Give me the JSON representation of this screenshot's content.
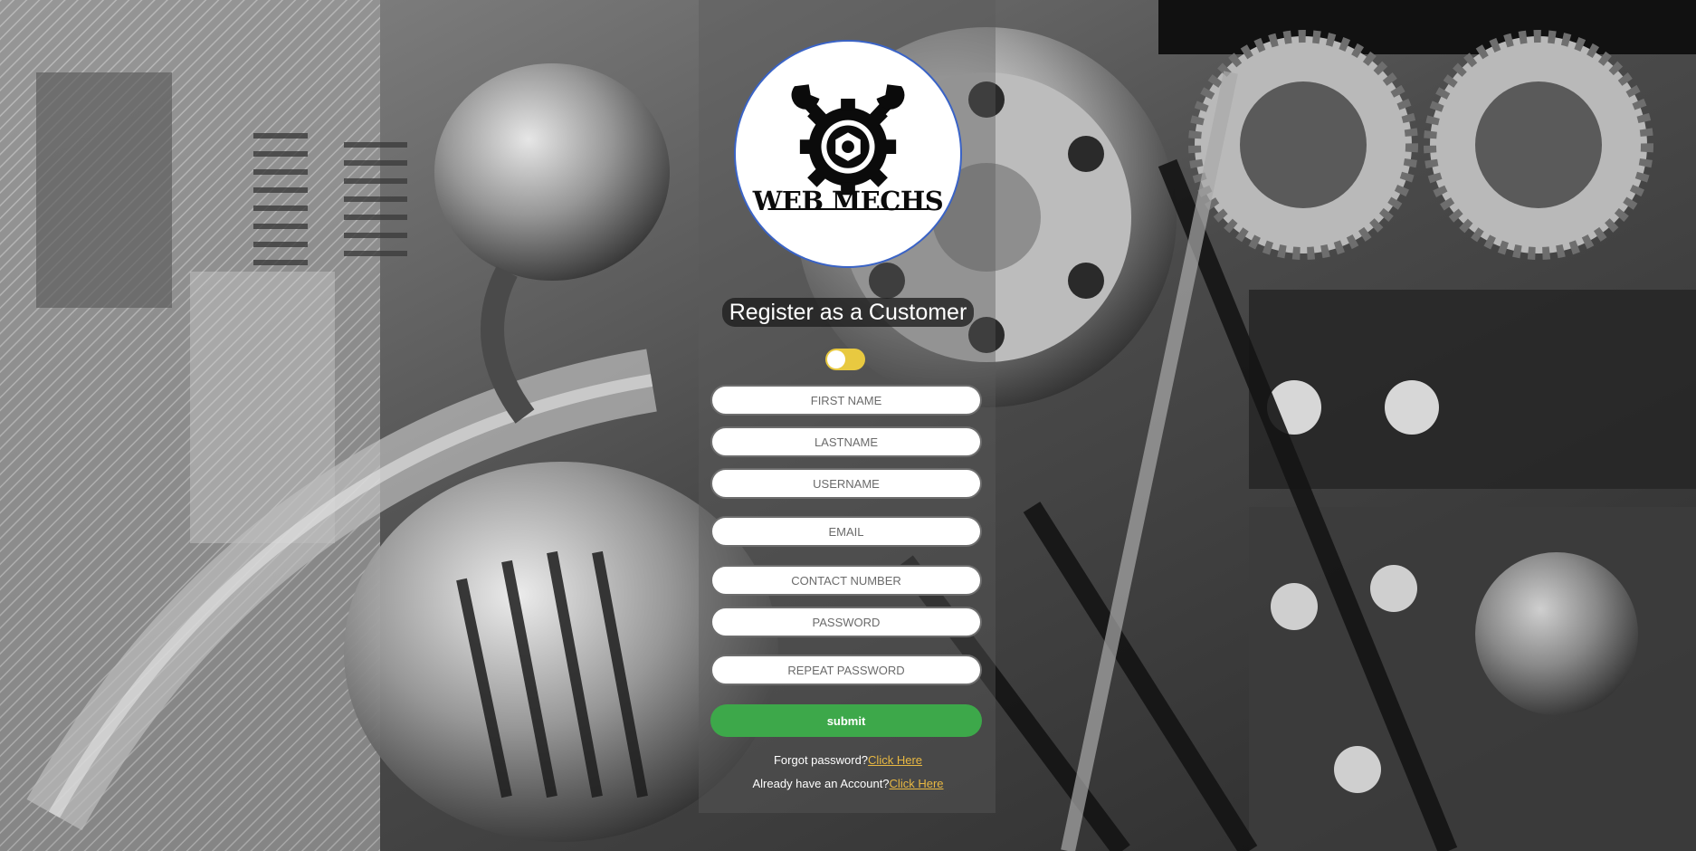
{
  "brand": {
    "logo_text": "WEB MECHS",
    "accent_border": "#3a63c6"
  },
  "form": {
    "title": "Register as a Customer",
    "role_toggle": {
      "state": "customer",
      "track_color": "#e8c940"
    },
    "fields": {
      "first_name": {
        "placeholder": "FIRST NAME",
        "value": ""
      },
      "last_name": {
        "placeholder": "LASTNAME",
        "value": ""
      },
      "username": {
        "placeholder": "USERNAME",
        "value": ""
      },
      "email": {
        "placeholder": "EMAIL",
        "value": ""
      },
      "contact": {
        "placeholder": "CONTACT NUMBER",
        "value": ""
      },
      "password": {
        "placeholder": "PASSWORD",
        "value": ""
      },
      "repeat_password": {
        "placeholder": "REPEAT PASSWORD",
        "value": ""
      }
    },
    "submit_label": "submit",
    "submit_color": "#3da84a"
  },
  "links": {
    "forgot_prompt": "Forgot password?",
    "forgot_link": "Click Here",
    "account_prompt": "Already have an Account?",
    "account_link": "Click Here",
    "link_color": "#e8b842"
  },
  "icons": {
    "logo_emblem": "wrench-gear-icon",
    "background": "engine-illustration"
  }
}
